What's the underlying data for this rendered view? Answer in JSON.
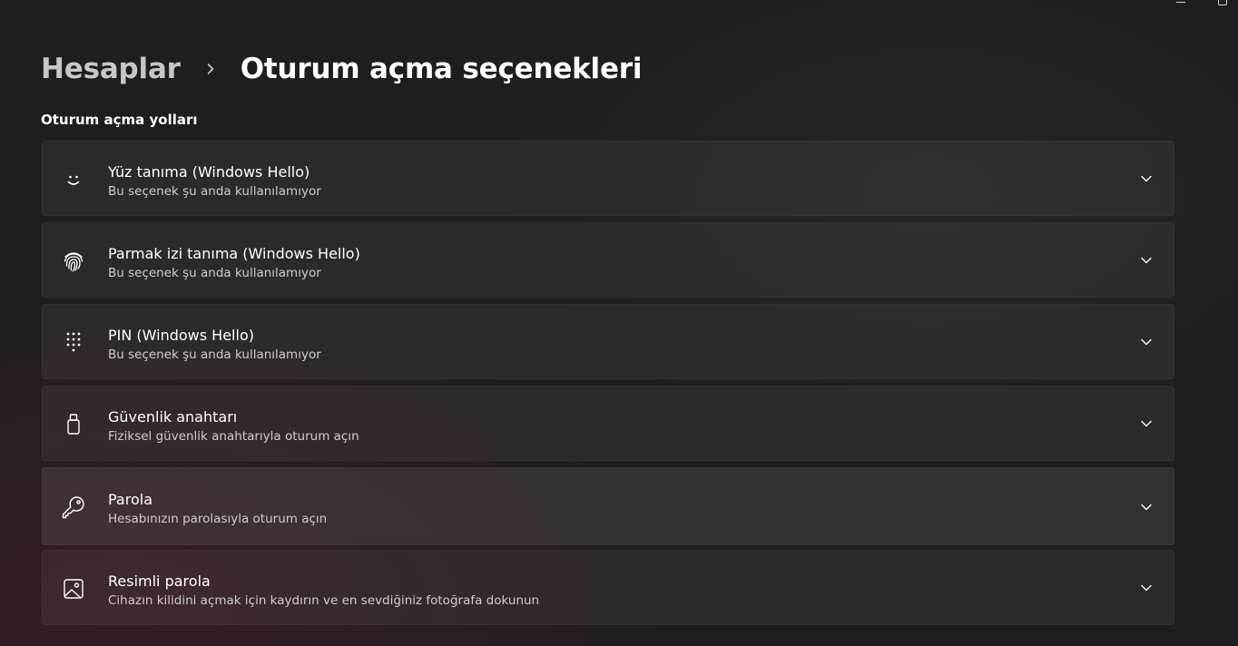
{
  "breadcrumb": {
    "parent": "Hesaplar",
    "current": "Oturum açma seçenekleri"
  },
  "section_title": "Oturum açma yolları",
  "options": [
    {
      "title": "Yüz tanıma (Windows Hello)",
      "subtitle": "Bu seçenek şu anda kullanılamıyor",
      "icon": "face-icon"
    },
    {
      "title": "Parmak izi tanıma (Windows Hello)",
      "subtitle": "Bu seçenek şu anda kullanılamıyor",
      "icon": "fingerprint-icon"
    },
    {
      "title": "PIN (Windows Hello)",
      "subtitle": "Bu seçenek şu anda kullanılamıyor",
      "icon": "pin-keypad-icon"
    },
    {
      "title": "Güvenlik anahtarı",
      "subtitle": "Fiziksel güvenlik anahtarıyla oturum açın",
      "icon": "usb-key-icon"
    },
    {
      "title": "Parola",
      "subtitle": "Hesabınızın parolasıyla oturum açın",
      "icon": "key-icon"
    },
    {
      "title": "Resimli parola",
      "subtitle": "Cihazın kilidini açmak için kaydırın ve en sevdiğiniz fotoğrafa dokunun",
      "icon": "picture-icon"
    }
  ],
  "colors": {
    "background": "#1f1d22",
    "card": "#2b292e",
    "text_primary": "#ffffff",
    "text_secondary": "#cfcdd2"
  }
}
